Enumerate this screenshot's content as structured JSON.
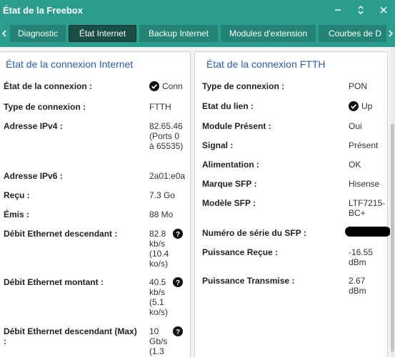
{
  "window": {
    "title": "État de la Freebox"
  },
  "tabs": [
    {
      "label": "Diagnostic"
    },
    {
      "label": "État Internet"
    },
    {
      "label": "Backup Internet"
    },
    {
      "label": "Modules d'extension"
    },
    {
      "label": "Courbes de D"
    }
  ],
  "left_panel": {
    "title": "État de la connexion Internet",
    "rows": [
      {
        "label": "État de la connexion :",
        "value": "Conn"
      },
      {
        "label": "Type de connexion :",
        "value": "FTTH"
      },
      {
        "label": "Adresse IPv4 :",
        "value": "82.65.46 (Ports 0 à 65535)"
      },
      {
        "label": "Adresse IPv6 :",
        "value": "2a01:e0a"
      },
      {
        "label": "Reçu :",
        "value": "7.3 Go"
      },
      {
        "label": "Émis :",
        "value": "88 Mo"
      },
      {
        "label": "Débit Ethernet descendant :",
        "value": "82.8 kb/s (10.4 ko/s)"
      },
      {
        "label": "Débit Ethernet montant :",
        "value": "40.5 kb/s (5.1 ko/s)"
      },
      {
        "label": "Débit Ethernet descendant (Max) :",
        "value": "10 Gb/s (1.3"
      }
    ]
  },
  "right_panel": {
    "title": "État de la connexion FTTH",
    "rows": [
      {
        "label": "Type de connexion :",
        "value": "PON"
      },
      {
        "label": "Etat du lien :",
        "value": "Up"
      },
      {
        "label": "Module Présent :",
        "value": "Oui"
      },
      {
        "label": "Signal :",
        "value": "Présent"
      },
      {
        "label": "Alimentation :",
        "value": "OK"
      },
      {
        "label": "Marque SFP :",
        "value": "Hisense"
      },
      {
        "label": "Modèle SFP :",
        "value": "LTF7215-BC+"
      },
      {
        "label": "Numéro de série du SFP :",
        "value": ""
      },
      {
        "label": "Puissance Reçue :",
        "value": "-16.55 dBm"
      },
      {
        "label": "Puissance Transmise :",
        "value": "2.67 dBm"
      }
    ]
  },
  "icons": {
    "minimize": "minimize-icon",
    "collapse": "chevron-up-down-icon",
    "close": "close-icon",
    "status": "check-circle-icon",
    "help": "help-circle-icon"
  },
  "colors": {
    "accent": "#2a9d8f",
    "active_tab": "#1a4d45",
    "panel_title": "#2a5db0"
  }
}
